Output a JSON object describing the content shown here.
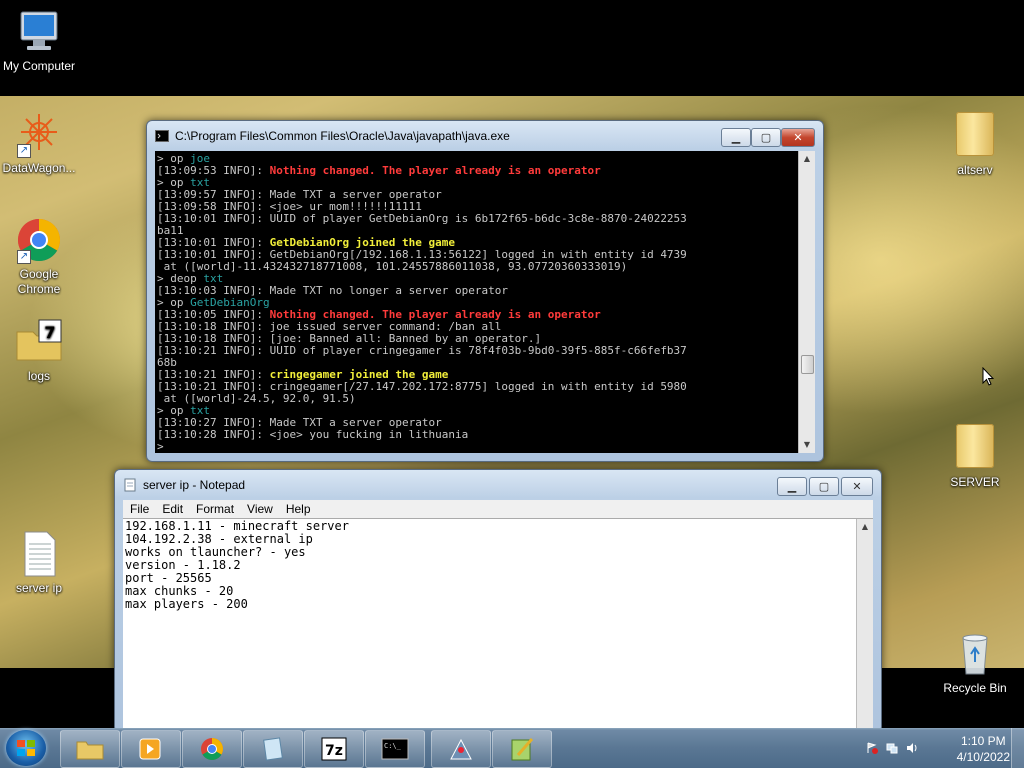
{
  "desktop": {
    "icons": [
      {
        "label": "My Computer"
      },
      {
        "label": "DataWagon..."
      },
      {
        "label": "Google\nChrome"
      },
      {
        "label": "logs"
      },
      {
        "label": "server ip"
      },
      {
        "label": "altserv"
      },
      {
        "label": "SERVER"
      },
      {
        "label": "Recycle Bin"
      }
    ]
  },
  "console": {
    "title": "C:\\Program Files\\Common Files\\Oracle\\Java\\javapath\\java.exe",
    "lines": [
      {
        "parts": [
          [
            "",
            "> op "
          ],
          [
            "teal",
            "joe"
          ]
        ]
      },
      {
        "parts": [
          [
            "",
            "[13:09:53 INFO]: "
          ],
          [
            "red",
            "Nothing changed. The player already is an operator"
          ]
        ]
      },
      {
        "parts": [
          [
            "",
            "> op "
          ],
          [
            "teal",
            "txt"
          ]
        ]
      },
      {
        "parts": [
          [
            "",
            "[13:09:57 INFO]: Made TXT a server operator"
          ]
        ]
      },
      {
        "parts": [
          [
            "",
            "[13:09:58 INFO]: <joe> ur mom!!!!!!11111"
          ]
        ]
      },
      {
        "parts": [
          [
            "",
            "[13:10:01 INFO]: UUID of player GetDebianOrg is 6b172f65-b6dc-3c8e-8870-24022253"
          ]
        ]
      },
      {
        "parts": [
          [
            "",
            "ba11"
          ]
        ]
      },
      {
        "parts": [
          [
            "",
            "[13:10:01 INFO]: "
          ],
          [
            "yellow",
            "GetDebianOrg joined the game"
          ]
        ]
      },
      {
        "parts": [
          [
            "",
            "[13:10:01 INFO]: GetDebianOrg[/192.168.1.13:56122] logged in with entity id 4739"
          ]
        ]
      },
      {
        "parts": [
          [
            "",
            " at ([world]-11.432432718771008, 101.24557886011038, 93.07720360333019)"
          ]
        ]
      },
      {
        "parts": [
          [
            "",
            "> deop "
          ],
          [
            "teal",
            "txt"
          ]
        ]
      },
      {
        "parts": [
          [
            "",
            "[13:10:03 INFO]: Made TXT no longer a server operator"
          ]
        ]
      },
      {
        "parts": [
          [
            "",
            "> op "
          ],
          [
            "teal",
            "GetDebianOrg"
          ]
        ]
      },
      {
        "parts": [
          [
            "",
            "[13:10:05 INFO]: "
          ],
          [
            "red",
            "Nothing changed. The player already is an operator"
          ]
        ]
      },
      {
        "parts": [
          [
            "",
            "[13:10:18 INFO]: joe issued server command: /ban all"
          ]
        ]
      },
      {
        "parts": [
          [
            "",
            "[13:10:18 INFO]: [joe: Banned all: Banned by an operator.]"
          ]
        ]
      },
      {
        "parts": [
          [
            "",
            "[13:10:21 INFO]: UUID of player cringegamer is 78f4f03b-9bd0-39f5-885f-c66fefb37"
          ]
        ]
      },
      {
        "parts": [
          [
            "",
            "68b"
          ]
        ]
      },
      {
        "parts": [
          [
            "",
            "[13:10:21 INFO]: "
          ],
          [
            "yellow",
            "cringegamer joined the game"
          ]
        ]
      },
      {
        "parts": [
          [
            "",
            "[13:10:21 INFO]: cringegamer[/27.147.202.172:8775] logged in with entity id 5980"
          ]
        ]
      },
      {
        "parts": [
          [
            "",
            " at ([world]-24.5, 92.0, 91.5)"
          ]
        ]
      },
      {
        "parts": [
          [
            "",
            "> op "
          ],
          [
            "teal",
            "txt"
          ]
        ]
      },
      {
        "parts": [
          [
            "",
            "[13:10:27 INFO]: Made TXT a server operator"
          ]
        ]
      },
      {
        "parts": [
          [
            "",
            "[13:10:28 INFO]: <joe> you fucking in lithuania"
          ]
        ]
      },
      {
        "parts": [
          [
            "",
            ">"
          ]
        ]
      }
    ]
  },
  "notepad": {
    "title": "server ip - Notepad",
    "menu": [
      "File",
      "Edit",
      "Format",
      "View",
      "Help"
    ],
    "lines": [
      "192.168.1.11 - minecraft server",
      "104.192.2.38 - external ip",
      "works on tlauncher? - yes",
      "version - 1.18.2",
      "port - 25565",
      "max chunks - 20",
      "max players - 200"
    ]
  },
  "taskbar": {
    "buttons": [
      "explorer",
      "media-player",
      "chrome",
      "notepad",
      "7zip",
      "command-prompt",
      "java",
      "notepad-plus"
    ],
    "time": "1:10 PM",
    "date": "4/10/2022"
  }
}
